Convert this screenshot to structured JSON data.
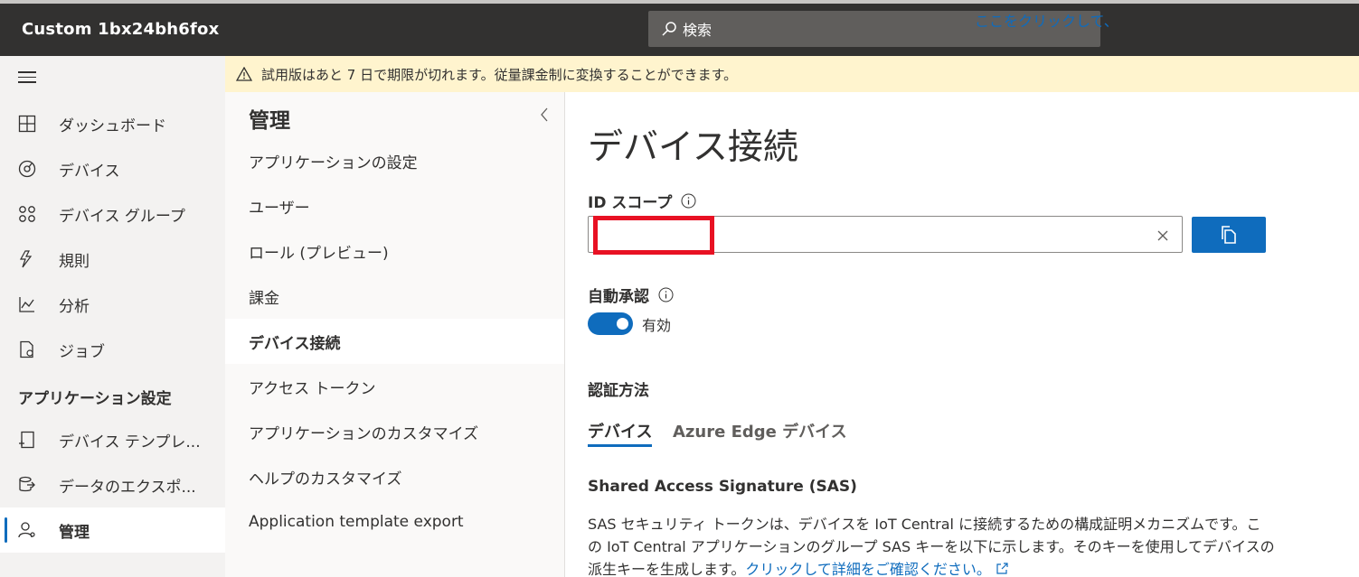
{
  "app": {
    "title": "Custom 1bx24bh6fox"
  },
  "search": {
    "label": "検索",
    "icon": "search-icon"
  },
  "banner": {
    "message": "試用版はあと 7 日で期限が切れます。従量課金制に変換することができます。",
    "link": "ここをクリックして、"
  },
  "leftnav": {
    "items": [
      {
        "label": "ダッシュボード",
        "icon": "dashboard-icon"
      },
      {
        "label": "デバイス",
        "icon": "device-icon"
      },
      {
        "label": "デバイス グループ",
        "icon": "device-groups-icon"
      },
      {
        "label": "規則",
        "icon": "rules-icon"
      },
      {
        "label": "分析",
        "icon": "analytics-icon"
      },
      {
        "label": "ジョブ",
        "icon": "jobs-icon"
      }
    ],
    "section_title": "アプリケーション設定",
    "settings_items": [
      {
        "label": "デバイス テンプレ...",
        "icon": "device-template-icon"
      },
      {
        "label": "データのエクスポ...",
        "icon": "data-export-icon"
      },
      {
        "label": "管理",
        "icon": "admin-icon"
      }
    ]
  },
  "subnav": {
    "title": "管理",
    "items": [
      "アプリケーションの設定",
      "ユーザー",
      "ロール (プレビュー)",
      "課金",
      "デバイス接続",
      "アクセス トークン",
      "アプリケーションのカスタマイズ",
      "ヘルプのカスタマイズ",
      "Application template export"
    ],
    "active_index": 4
  },
  "main": {
    "title": "デバイス接続",
    "id_scope_label": "ID スコープ",
    "id_scope_value": "",
    "auto_approve_label": "自動承認",
    "auto_approve_state": "有効",
    "auth_method_label": "認証方法",
    "tabs": [
      "デバイス",
      "Azure Edge デバイス"
    ],
    "sas_heading": "Shared Access Signature (SAS)",
    "sas_description": "SAS セキュリティ トークンは、デバイスを IoT Central に接続するための構成証明メカニズムです。この IoT Central アプリケーションのグループ SAS キーを以下に示します。そのキーを使用してデバイスの派生キーを生成します。",
    "sas_link": "クリックして詳細をご確認ください。"
  },
  "colors": {
    "accent": "#0f6cbd",
    "topbar": "#323130",
    "banner": "#fff4ce",
    "redaction": "#e81123"
  }
}
